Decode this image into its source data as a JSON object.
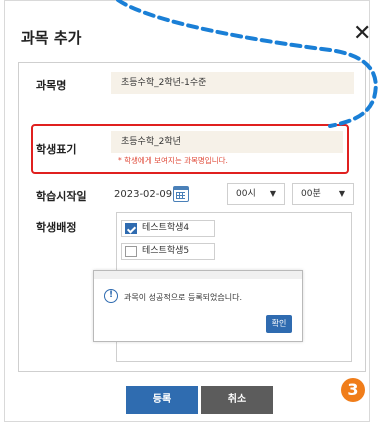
{
  "modal": {
    "title": "과목 추가",
    "close_icon": "close-icon"
  },
  "form": {
    "subject_name": {
      "label": "과목명",
      "value": "초등수학_2학년-1수준"
    },
    "student_display": {
      "label": "학생표기",
      "value": "초등수학_2학년",
      "helper": "* 학생에게 보여지는 과목명입니다."
    },
    "start_date": {
      "label": "학습시작일",
      "value": "2023-02-09",
      "calendar_icon": "calendar-icon",
      "hour": "00시",
      "minute": "00분",
      "dropdown_icon": "▼"
    },
    "assignment": {
      "label": "학생배정",
      "students": [
        {
          "name": "테스트학생4",
          "checked": true
        },
        {
          "name": "테스트학생5",
          "checked": false
        }
      ]
    }
  },
  "alert": {
    "icon": "info-icon",
    "icon_glyph": "!",
    "message": "과목이 성공적으로 등록되었습니다.",
    "confirm": "확인"
  },
  "buttons": {
    "register": "등록",
    "cancel": "취소"
  },
  "step_badge": "3",
  "colors": {
    "highlight": "#e0201f",
    "primary": "#2f6cb0",
    "secondary": "#5c5c5c",
    "badge": "#f07d1a",
    "field_bg": "#f6f1e8"
  }
}
